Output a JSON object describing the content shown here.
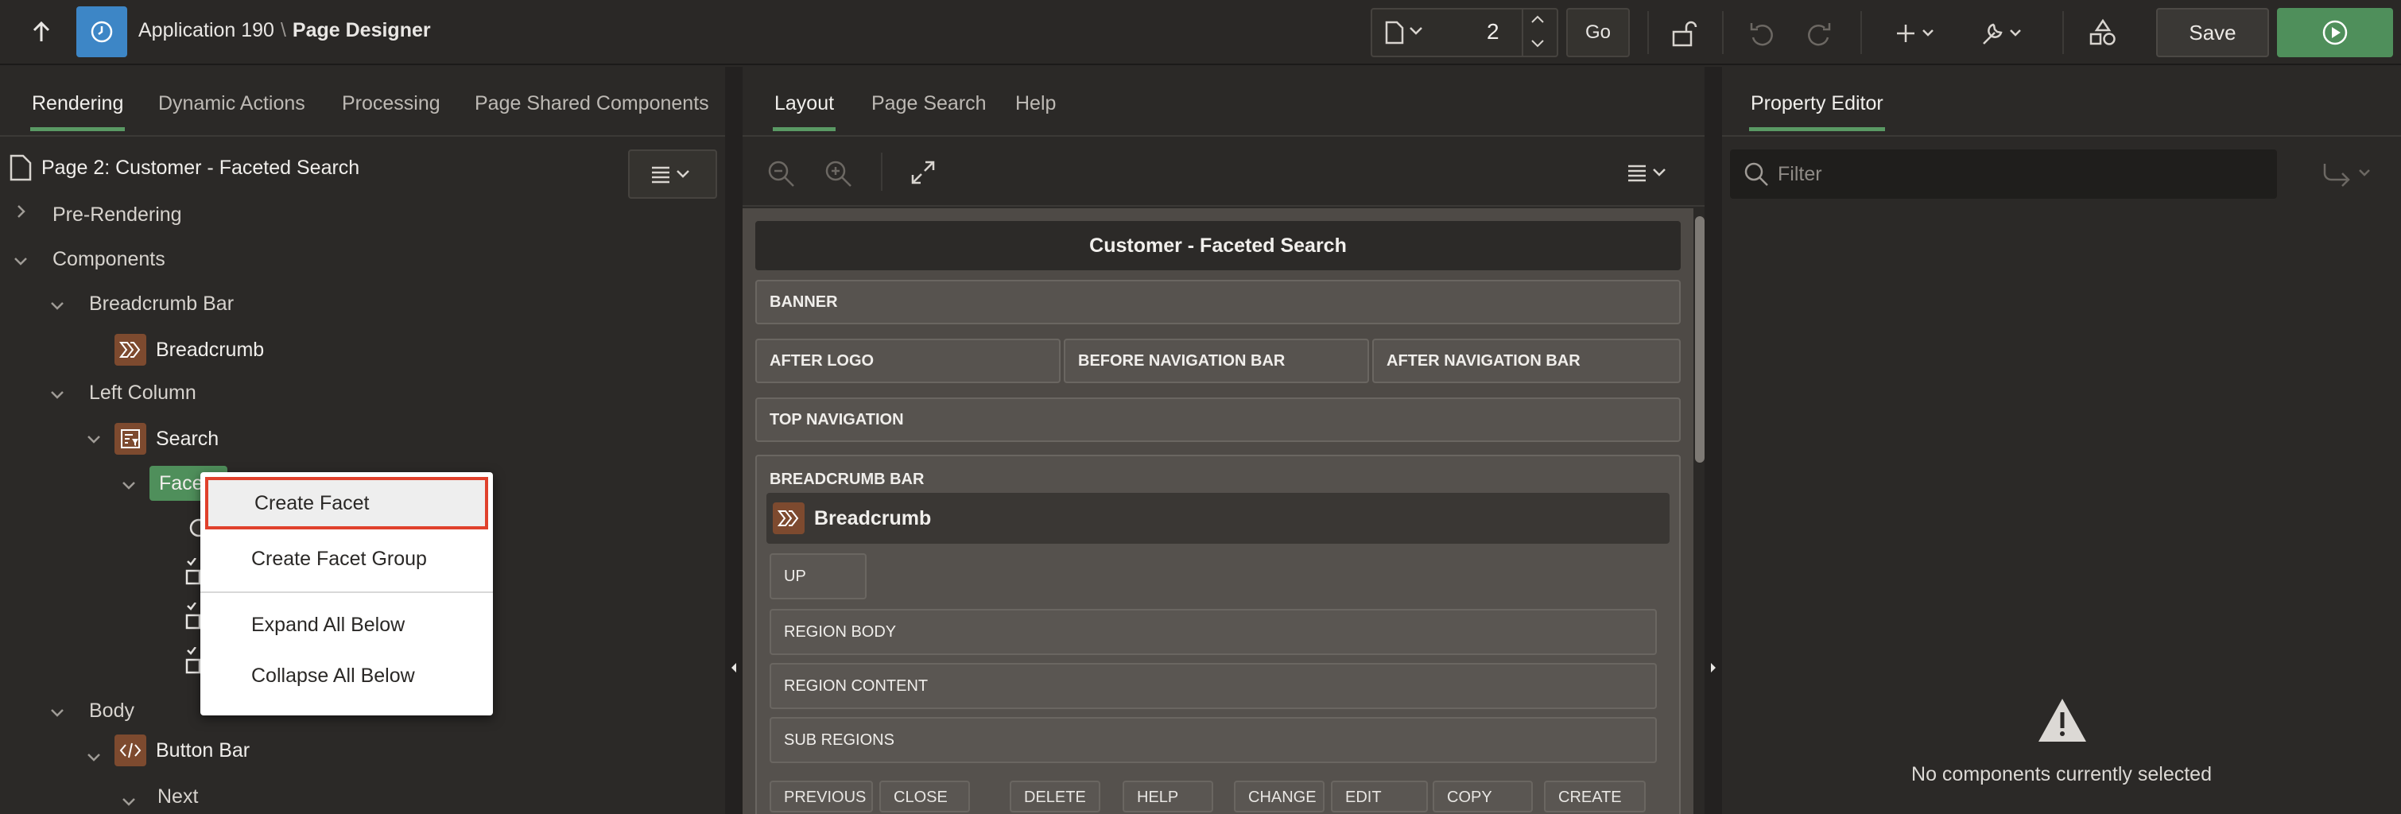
{
  "app": {
    "title": "Application 190",
    "separator": "\\",
    "page_designer": "Page Designer"
  },
  "toolbar": {
    "page_number": "2",
    "go_label": "Go",
    "save_label": "Save"
  },
  "left_panel": {
    "tabs": [
      "Rendering",
      "Dynamic Actions",
      "Processing",
      "Page Shared Components"
    ],
    "active_tab": "Rendering",
    "page_title": "Page 2: Customer - Faceted Search",
    "tree": {
      "pre_rendering": "Pre-Rendering",
      "components": "Components",
      "breadcrumb_bar": "Breadcrumb Bar",
      "breadcrumb": "Breadcrumb",
      "left_column": "Left Column",
      "search": "Search",
      "facets": "Face",
      "body": "Body",
      "button_bar": "Button Bar",
      "next": "Next"
    }
  },
  "context_menu": {
    "items": [
      "Create Facet",
      "Create Facet Group",
      "Expand All Below",
      "Collapse All Below"
    ],
    "highlighted": "Create Facet"
  },
  "center_panel": {
    "tabs": [
      "Layout",
      "Page Search",
      "Help"
    ],
    "active_tab": "Layout",
    "page_header": "Customer - Faceted Search",
    "slots": {
      "banner": "BANNER",
      "after_logo": "AFTER LOGO",
      "before_nav": "BEFORE NAVIGATION BAR",
      "after_nav": "AFTER NAVIGATION BAR",
      "top_nav": "TOP NAVIGATION",
      "breadcrumb_bar": "BREADCRUMB BAR"
    },
    "breadcrumb_region": {
      "title": "Breadcrumb",
      "up": "UP",
      "region_body": "REGION BODY",
      "region_content": "REGION CONTENT",
      "sub_regions": "SUB REGIONS"
    },
    "button_positions": [
      "PREVIOUS",
      "CLOSE",
      "DELETE",
      "HELP",
      "CHANGE",
      "EDIT",
      "COPY",
      "CREATE"
    ]
  },
  "right_panel": {
    "tab": "Property Editor",
    "filter_placeholder": "Filter",
    "empty_message": "No components currently selected"
  },
  "colors": {
    "accent_green": "#4f8f5b",
    "app_icon_blue": "#3d86c6",
    "highlight_red": "#e0412c",
    "component_icon_brown": "#7d4a2f"
  }
}
